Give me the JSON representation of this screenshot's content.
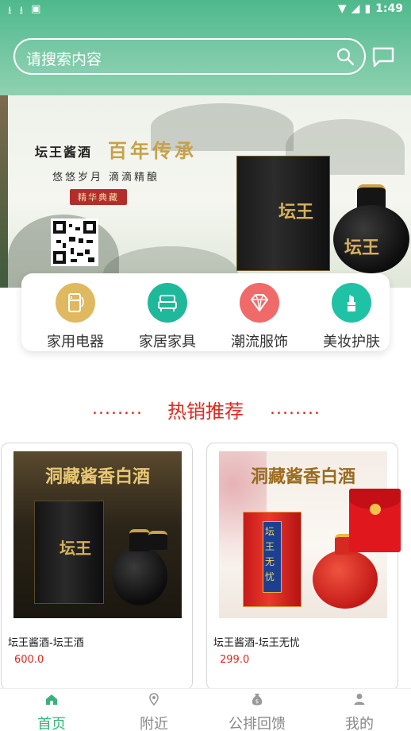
{
  "status_bar": {
    "time": "1:49"
  },
  "search": {
    "placeholder": "请搜索内容"
  },
  "banner": {
    "brand": "坛王酱酒",
    "headline": "百年传承",
    "slogan": "悠悠岁月 滴滴精酿",
    "tag": "精华典藏",
    "product_label": "坛王"
  },
  "categories": [
    {
      "label": "家用电器",
      "icon": "fridge-icon",
      "color": "#e0b860"
    },
    {
      "label": "家居家具",
      "icon": "sofa-icon",
      "color": "#1fb89b"
    },
    {
      "label": "潮流服饰",
      "icon": "diamond-icon",
      "color": "#f06a6a"
    },
    {
      "label": "美妆护肤",
      "icon": "lipstick-icon",
      "color": "#20c2a5"
    }
  ],
  "section": {
    "title": "热销推荐",
    "dots": "........"
  },
  "products": [
    {
      "image_title": "洞藏酱香白酒",
      "image_label": "坛王",
      "name": "坛王酱酒-坛王酒",
      "price": "600.0"
    },
    {
      "image_title": "洞藏酱香白酒",
      "image_label": "坛王无忧",
      "name": "坛王酱酒-坛王无忧",
      "price": "299.0"
    }
  ],
  "tabs": [
    {
      "label": "首页",
      "icon": "home-icon",
      "active": true
    },
    {
      "label": "附近",
      "icon": "location-icon",
      "active": false
    },
    {
      "label": "公排回馈",
      "icon": "money-bag-icon",
      "active": false
    },
    {
      "label": "我的",
      "icon": "person-icon",
      "active": false
    }
  ],
  "colors": {
    "accent": "#38b27b",
    "header": "#5fbf95",
    "price": "#e1281f"
  }
}
